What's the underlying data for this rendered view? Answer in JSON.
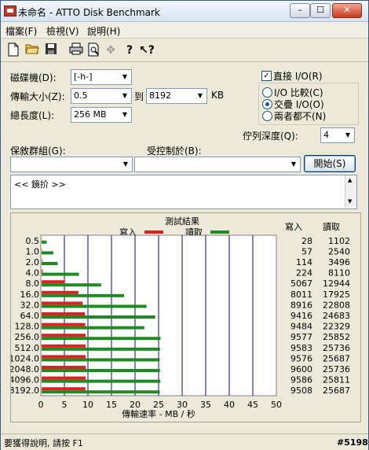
{
  "window": {
    "title": "未命名 - ATTO Disk Benchmark",
    "buttons": {
      "minimize": "–",
      "maximize": "☐",
      "close": "✕"
    }
  },
  "menu": [
    "檔案(F)",
    "檢視(V)",
    "說明(H)"
  ],
  "toolbar": [
    "new-icon",
    "open-folder-icon",
    "save-icon",
    "print-icon",
    "print-preview-icon",
    "move-icon",
    "help-icon",
    "context-help-icon"
  ],
  "form": {
    "drive_label": "磁碟機(D):",
    "drive_value": "[-h-]",
    "transfer_label": "傳輸大小(Z):",
    "transfer_from": "0.5",
    "to_label": "到",
    "transfer_to": "8192",
    "kb_label": "KB",
    "length_label": "總長度(L):",
    "length_value": "256 MB",
    "direct_io_label": "直接 I/O(R)",
    "direct_io_checked": true,
    "io_comp_label": "I/O 比較(C)",
    "overlap_io_label": "交疊 I/O(O)",
    "neither_label": "兩者都不(N)",
    "selected_mode": "overlap",
    "queue_label": "佇列深度(Q):",
    "queue_value": "4",
    "controlled_group_label": "保敘群組(G):",
    "controlled_by_label": "受控制於(B):",
    "controlled_group_value": "",
    "controlled_by_value": "",
    "start_button": "開始(S)",
    "description": "<< 鏡扴 >>"
  },
  "chart_data": {
    "type": "bar",
    "title": "測試結果",
    "legend": {
      "write": "寫入",
      "read": "讀取",
      "placement": "top"
    },
    "colors": {
      "write": "#e02020",
      "read": "#1f8a1f",
      "grid": "#0a0a80"
    },
    "categories": [
      "0.5",
      "1.0",
      "2.0",
      "4.0",
      "8.0",
      "16.0",
      "32.0",
      "64.0",
      "128.0",
      "256.0",
      "512.0",
      "1024.0",
      "2048.0",
      "4096.0",
      "8192.0"
    ],
    "series": [
      {
        "name": "寫入",
        "values": [
          0.03,
          0.06,
          0.11,
          0.22,
          4.95,
          7.82,
          8.71,
          9.2,
          9.26,
          9.35,
          9.36,
          9.35,
          9.38,
          9.36,
          9.29
        ]
      },
      {
        "name": "讀取",
        "values": [
          1.08,
          2.48,
          3.41,
          7.92,
          12.64,
          17.5,
          22.27,
          24.1,
          21.8,
          25.25,
          25.13,
          25.08,
          25.13,
          25.21,
          25.08
        ]
      }
    ],
    "xlabel": "傳輸速率 - MB / 秒",
    "xlim": [
      0,
      50
    ],
    "xticks": [
      "0",
      "5",
      "10",
      "15",
      "20",
      "25",
      "30",
      "35",
      "40",
      "45",
      "50"
    ],
    "grid": true,
    "table_headers": {
      "write": "寫入",
      "read": "讀取"
    },
    "write_kbs": [
      "28",
      "57",
      "114",
      "224",
      "5067",
      "8011",
      "8916",
      "9416",
      "9484",
      "9577",
      "9583",
      "9576",
      "9600",
      "9586",
      "9508"
    ],
    "read_kbs": [
      "1102",
      "2540",
      "3496",
      "8110",
      "12944",
      "17925",
      "22808",
      "24683",
      "22329",
      "25852",
      "25736",
      "25687",
      "25736",
      "25811",
      "25687"
    ]
  },
  "status": {
    "text": "要獲得說明, 請按 F1",
    "tag": "#5198"
  }
}
